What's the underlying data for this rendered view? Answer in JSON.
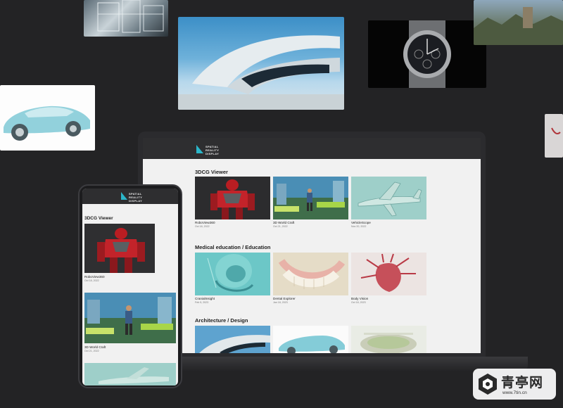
{
  "laptop": {
    "logo_lines": [
      "SPATIAL",
      "REALITY",
      "DISPLAY"
    ],
    "sections": [
      {
        "title": "3DCG Viewer",
        "items": [
          {
            "name": "RoboView360",
            "date": "Oct 18, 2022"
          },
          {
            "name": "3D World Craft",
            "date": "Oct 21, 2022"
          },
          {
            "name": "VehicleScope",
            "date": "Nov 20, 2022"
          }
        ]
      },
      {
        "title": "Medical education / Education",
        "items": [
          {
            "name": "CranialInsight",
            "date": "Feb 5, 2023"
          },
          {
            "name": "Dental Explorer",
            "date": "Jan 18, 2023"
          },
          {
            "name": "Body Vision",
            "date": "Oct 18, 2023"
          }
        ]
      },
      {
        "title": "Architecture / Design",
        "items": []
      }
    ]
  },
  "phone": {
    "logo_lines": [
      "SPATIAL",
      "REALITY",
      "DISPLAY"
    ],
    "section_title": "3DCG Viewer",
    "items": [
      {
        "name": "RoboView360",
        "date": "Oct 18, 2022"
      },
      {
        "name": "3D World Craft",
        "date": "Oct 21, 2022"
      }
    ]
  },
  "watermark": {
    "title": "青亭网",
    "url": "www.7tin.cn"
  },
  "colors": {
    "accent": "#2bb6c9",
    "background": "#232325"
  },
  "icons": [
    "logo-mark-icon",
    "hexagon-logo-icon"
  ]
}
